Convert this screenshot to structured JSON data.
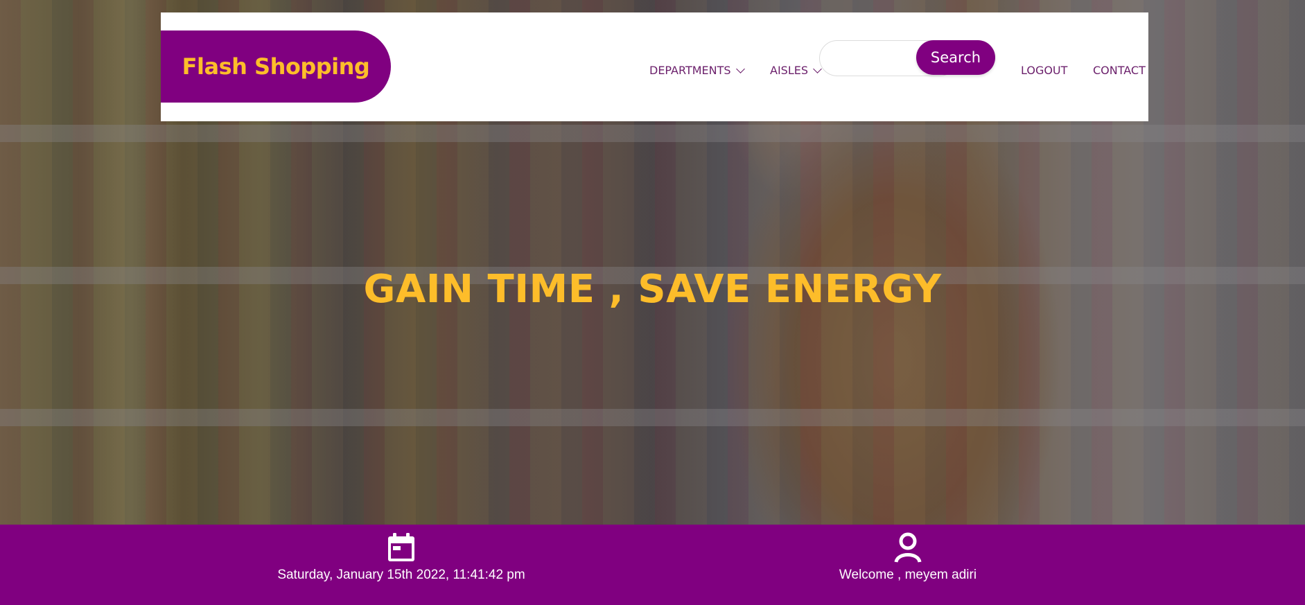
{
  "brand": {
    "name": "Flash Shopping",
    "primary_color": "#800080",
    "accent_color": "#fdbd2a"
  },
  "nav": {
    "departments_label": "DEPARTMENTS",
    "aisles_label": "AISLES",
    "search_placeholder": "",
    "search_value": "",
    "search_button_label": "Search",
    "logout_label": "LOGOUT",
    "contact_label": "CONTACT"
  },
  "hero": {
    "title": "GAIN TIME , SAVE ENERGY"
  },
  "footer": {
    "datetime": "Saturday, January 15th 2022, 11:41:42 pm",
    "datetime_icon": "calendar-icon",
    "welcome": "Welcome , meyem adiri",
    "welcome_icon": "user-icon"
  }
}
